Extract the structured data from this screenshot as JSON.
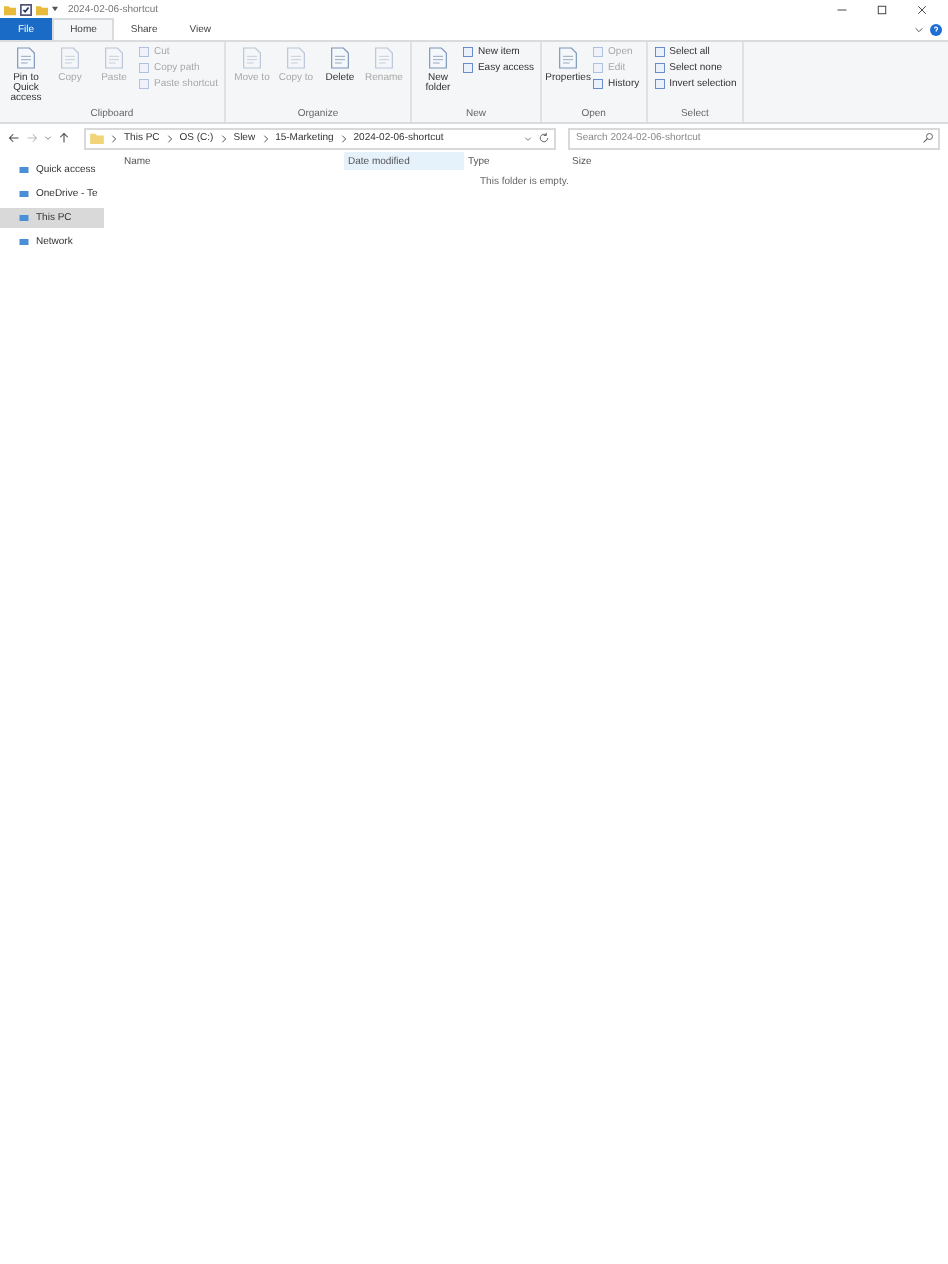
{
  "window": {
    "title": "2024-02-06-shortcut"
  },
  "tabs": [
    {
      "label": "File",
      "kind": "file",
      "selected": false
    },
    {
      "label": "Home",
      "kind": "tab",
      "selected": true
    },
    {
      "label": "Share",
      "kind": "tab",
      "selected": false
    },
    {
      "label": "View",
      "kind": "tab",
      "selected": false
    }
  ],
  "ribbon": [
    {
      "label": "Clipboard",
      "items": [
        {
          "label": "Pin to Quick access",
          "kind": "large",
          "disabled": false
        },
        {
          "label": "Copy",
          "kind": "large",
          "disabled": true
        },
        {
          "label": "Paste",
          "kind": "large",
          "disabled": true
        },
        {
          "label": "Cut",
          "kind": "small",
          "disabled": true
        },
        {
          "label": "Copy path",
          "kind": "small",
          "disabled": true
        },
        {
          "label": "Paste shortcut",
          "kind": "small",
          "disabled": true
        }
      ]
    },
    {
      "label": "Organize",
      "items": [
        {
          "label": "Move to",
          "kind": "large",
          "disabled": true
        },
        {
          "label": "Copy to",
          "kind": "large",
          "disabled": true
        },
        {
          "label": "Delete",
          "kind": "large",
          "disabled": false
        },
        {
          "label": "Rename",
          "kind": "large",
          "disabled": true
        }
      ]
    },
    {
      "label": "New",
      "items": [
        {
          "label": "New folder",
          "kind": "large",
          "disabled": false
        },
        {
          "label": "New item",
          "kind": "small",
          "disabled": false
        },
        {
          "label": "Easy access",
          "kind": "small",
          "disabled": false
        }
      ]
    },
    {
      "label": "Open",
      "items": [
        {
          "label": "Properties",
          "kind": "large",
          "disabled": false
        },
        {
          "label": "Open",
          "kind": "small",
          "disabled": true
        },
        {
          "label": "Edit",
          "kind": "small",
          "disabled": true
        },
        {
          "label": "History",
          "kind": "small",
          "disabled": false
        }
      ]
    },
    {
      "label": "Select",
      "items": [
        {
          "label": "Select all",
          "kind": "small",
          "disabled": false
        },
        {
          "label": "Select none",
          "kind": "small",
          "disabled": false
        },
        {
          "label": "Invert selection",
          "kind": "small",
          "disabled": false
        }
      ]
    }
  ],
  "address": {
    "breadcrumbs": [
      "This PC",
      "OS (C:)",
      "Slew",
      "15-Marketing",
      "2024-02-06-shortcut"
    ],
    "search_placeholder": "Search 2024-02-06-shortcut"
  },
  "nav": [
    {
      "label": "Quick access",
      "selected": false
    },
    {
      "label": "OneDrive - Te",
      "selected": false
    },
    {
      "label": "This PC",
      "selected": true
    },
    {
      "label": "Network",
      "selected": false
    }
  ],
  "columns": [
    {
      "label": "Name",
      "highlighted": false
    },
    {
      "label": "Date modified",
      "highlighted": true
    },
    {
      "label": "Type",
      "highlighted": false
    },
    {
      "label": "Size",
      "highlighted": false
    }
  ],
  "empty_message": "This folder is empty."
}
